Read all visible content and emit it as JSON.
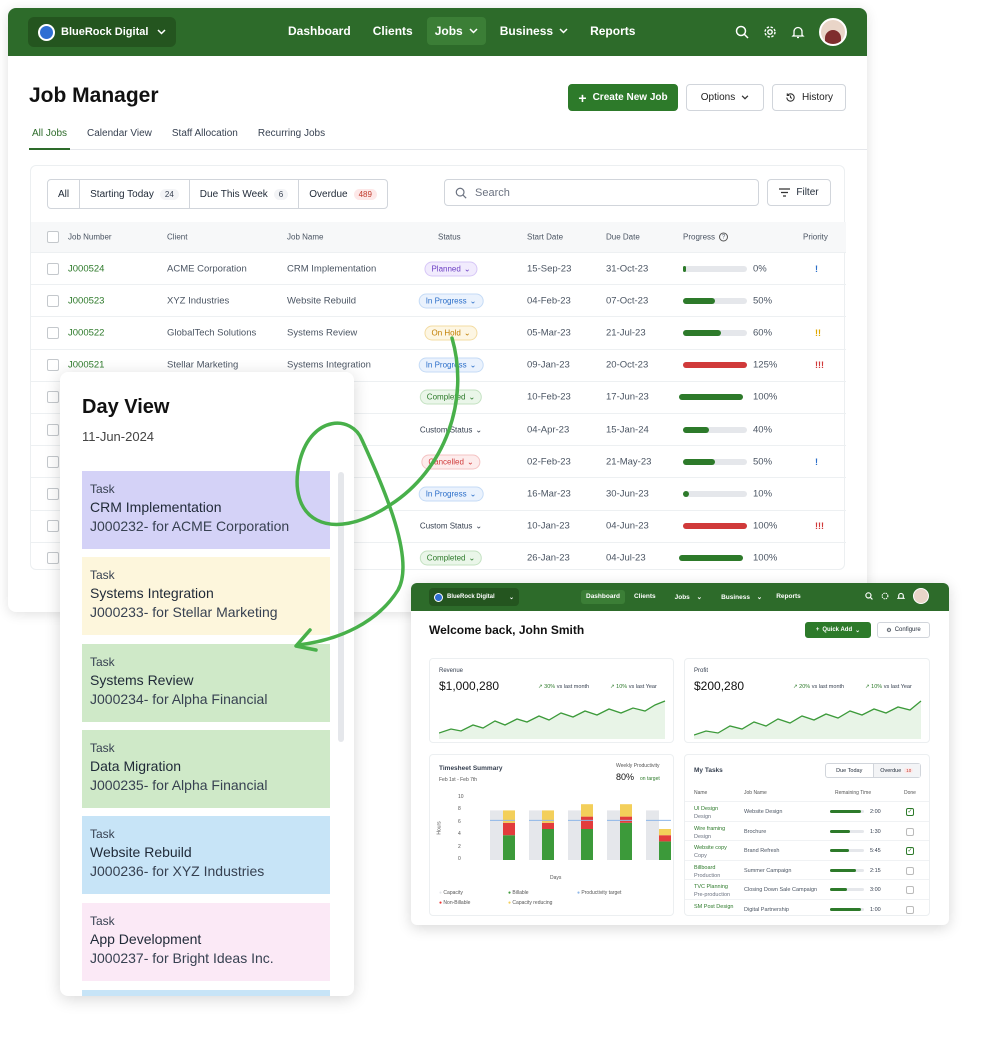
{
  "main": {
    "nav": {
      "brand": "BlueRock Digital",
      "links": [
        "Dashboard",
        "Clients",
        "Jobs",
        "Business",
        "Reports"
      ]
    },
    "title": "Job Manager",
    "buttons": {
      "create": "Create New Job",
      "options": "Options",
      "history": "History"
    },
    "tabs": [
      "All Jobs",
      "Calendar View",
      "Staff Allocation",
      "Recurring Jobs"
    ],
    "filters": [
      {
        "label": "All",
        "count": ""
      },
      {
        "label": "Starting Today",
        "count": "24"
      },
      {
        "label": "Due This Week",
        "count": "6"
      },
      {
        "label": "Overdue",
        "count": "489"
      }
    ],
    "search_placeholder": "Search",
    "filter_label": "Filter",
    "columns": [
      "Job Number",
      "Client",
      "Job Name",
      "Status",
      "Start Date",
      "Due Date",
      "Progress",
      "Priority"
    ],
    "rows": [
      {
        "job": "J000524",
        "client": "ACME Corporation",
        "name": "CRM Implementation",
        "status": "Planned",
        "kind": "planned",
        "start": "15-Sep-23",
        "due": "31-Oct-23",
        "progress": 0,
        "pct": "0%",
        "priority": "!",
        "pcolor": "#2c6fc9"
      },
      {
        "job": "J000523",
        "client": "XYZ Industries",
        "name": "Website Rebuild",
        "status": "In Progress",
        "kind": "prog",
        "start": "04-Feb-23",
        "due": "07-Oct-23",
        "progress": 50,
        "pct": "50%",
        "priority": "",
        "pcolor": ""
      },
      {
        "job": "J000522",
        "client": "GlobalTech Solutions",
        "name": "Systems Review",
        "status": "On Hold",
        "kind": "hold",
        "start": "05-Mar-23",
        "due": "21-Jul-23",
        "progress": 60,
        "pct": "60%",
        "priority": "!!",
        "pcolor": "#e0a800"
      },
      {
        "job": "J000521",
        "client": "Stellar Marketing",
        "name": "Systems Integration",
        "status": "In Progress",
        "kind": "prog",
        "start": "09-Jan-23",
        "due": "20-Oct-23",
        "progress": 125,
        "pct": "125%",
        "priority": "!!!",
        "pcolor": "#d03a3a"
      },
      {
        "job": "",
        "client": "",
        "name": "",
        "status": "Completed",
        "kind": "done",
        "start": "10-Feb-23",
        "due": "17-Jun-23",
        "progress": 100,
        "pct": "100%",
        "priority": "",
        "pcolor": ""
      },
      {
        "job": "",
        "client": "",
        "name": "",
        "status": "Custom Status",
        "kind": "custom",
        "start": "04-Apr-23",
        "due": "15-Jan-24",
        "progress": 40,
        "pct": "40%",
        "priority": "",
        "pcolor": ""
      },
      {
        "job": "",
        "client": "",
        "name": "",
        "status": "Cancelled",
        "kind": "canc",
        "start": "02-Feb-23",
        "due": "21-May-23",
        "progress": 50,
        "pct": "50%",
        "priority": "!",
        "pcolor": "#2c6fc9"
      },
      {
        "job": "",
        "client": "",
        "name": "",
        "status": "In Progress",
        "kind": "prog",
        "start": "16-Mar-23",
        "due": "30-Jun-23",
        "progress": 10,
        "pct": "10%",
        "priority": "",
        "pcolor": ""
      },
      {
        "job": "",
        "client": "",
        "name": "",
        "status": "Custom Status",
        "kind": "custom",
        "start": "10-Jan-23",
        "due": "04-Jun-23",
        "progress": 100,
        "pct": "100%",
        "priority": "!!!",
        "pcolor": "#d03a3a",
        "over": true
      },
      {
        "job": "",
        "client": "",
        "name": "",
        "status": "Completed",
        "kind": "done",
        "start": "26-Jan-23",
        "due": "04-Jul-23",
        "progress": 100,
        "pct": "100%",
        "priority": "",
        "pcolor": ""
      }
    ]
  },
  "day_view": {
    "title": "Day View",
    "date": "11-Jun-2024",
    "tasks": [
      {
        "type": "Task",
        "name": "CRM Implementation",
        "desc": "J000232- for ACME Corporation",
        "color": "#d4d2f7"
      },
      {
        "type": "Task",
        "name": "Systems Integration",
        "desc": "J000233- for Stellar Marketing",
        "color": "#fdf6dc"
      },
      {
        "type": "Task",
        "name": "Systems Review",
        "desc": "J000234- for Alpha Financial",
        "color": "#cfe9c8"
      },
      {
        "type": "Task",
        "name": "Data Migration",
        "desc": "J000235- for Alpha Financial",
        "color": "#cfe9c8"
      },
      {
        "type": "Task",
        "name": "Website Rebuild",
        "desc": "J000236- for XYZ Industries",
        "color": "#c7e4f7"
      },
      {
        "type": "Task",
        "name": "App Development",
        "desc": "J000237- for Bright Ideas Inc.",
        "color": "#fbe9f6"
      }
    ]
  },
  "dashboard": {
    "nav": {
      "brand": "BlueRock Digital",
      "links": [
        "Dashboard",
        "Clients",
        "Jobs",
        "Business",
        "Reports"
      ]
    },
    "welcome": "Welcome back, John Smith",
    "quick_add": "Quick Add",
    "configure": "Configure",
    "revenue": {
      "label": "Revenue",
      "value": "$1,000,280",
      "trend1": "30%",
      "trend1_label": "vs last month",
      "trend2": "10%",
      "trend2_label": "vs last Year"
    },
    "profit": {
      "label": "Profit",
      "value": "$200,280",
      "trend1": "20%",
      "trend1_label": "vs last month",
      "trend2": "10%",
      "trend2_label": "vs last Year"
    },
    "timesheet": {
      "title": "Timesheet Summary",
      "range": "Feb 1st - Feb 7th",
      "wp_label": "Weekly Productivity",
      "wp_value": "80%",
      "wp_status": "on target",
      "ylabel": "Hours",
      "xlabel": "Days",
      "yticks": [
        "10",
        "8",
        "6",
        "4",
        "2",
        "0"
      ],
      "legend": [
        "Capacity",
        "Billable",
        "Productivity target",
        "Non-Billable",
        "Capacity reducing"
      ]
    },
    "tasks": {
      "title": "My Tasks",
      "tab1": "Due Today",
      "tab2": "Overdue",
      "tab2_count": "10",
      "columns": [
        "Name",
        "Job Name",
        "Remaining Time",
        "Done"
      ],
      "rows": [
        {
          "name": "UI Design",
          "sub": "Design",
          "job": "Website Design",
          "fill": 0.9,
          "time": "2:00",
          "done": true
        },
        {
          "name": "Wire framing",
          "sub": "Design",
          "job": "Brochure",
          "fill": 0.6,
          "time": "1:30",
          "done": false
        },
        {
          "name": "Website copy",
          "sub": "Copy",
          "job": "Brand Refresh",
          "fill": 0.55,
          "time": "5:45",
          "done": true
        },
        {
          "name": "Billboard",
          "sub": "Production",
          "job": "Summer Campaign",
          "fill": 0.75,
          "time": "2:15",
          "done": false
        },
        {
          "name": "TVC Planning",
          "sub": "Pre-production",
          "job": "Closing Down Sale Campaign",
          "fill": 0.5,
          "time": "3:00",
          "done": false
        },
        {
          "name": "SM Post Design",
          "sub": "",
          "job": "Digital Partnership",
          "fill": 0.9,
          "time": "1:00",
          "done": false
        }
      ]
    }
  }
}
